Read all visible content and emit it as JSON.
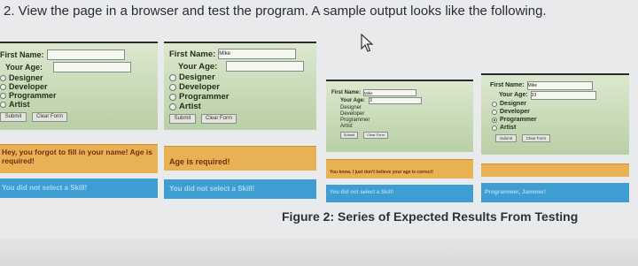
{
  "instruction": "2. View the page in a browser and test the program. A sample output looks like the following.",
  "caption": "Figure 2: Series of Expected Results From Testing",
  "form": {
    "first_name_label": "First Name:",
    "age_label": "Your Age:",
    "options": [
      "Designer",
      "Developer",
      "Programmer",
      "Artist"
    ],
    "submit_label": "Submit",
    "clear_label": "Clear Form"
  },
  "panels": [
    {
      "first_name_value": "",
      "age_value": "",
      "selected_option": null,
      "error_text": "Hey, you forgot to fill in your name! Age is required!",
      "skill_text": "You did not select a Skill!"
    },
    {
      "first_name_value": "Mike",
      "age_value": "",
      "selected_option": null,
      "error_text": "Age is required!",
      "skill_text": "You did not select a Skill!"
    },
    {
      "first_name_value": "Mike",
      "age_value": "3",
      "selected_option": null,
      "error_text": "You know, I just don't believe your age is correct!",
      "skill_text": "You did not select a Skill!"
    },
    {
      "first_name_value": "Mike",
      "age_value": "33",
      "selected_option": "Programmer",
      "error_text": "",
      "skill_text": "Programmer, Jammer!"
    }
  ]
}
